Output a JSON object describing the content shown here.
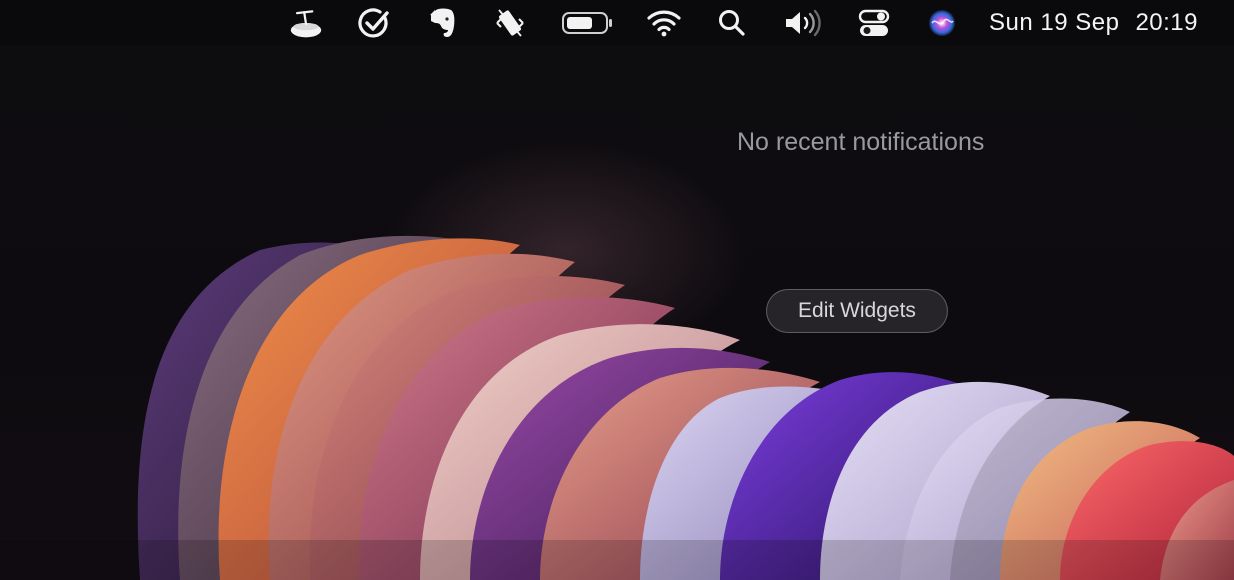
{
  "menubar": {
    "icons": [
      {
        "name": "dish-drawer-icon"
      },
      {
        "name": "things-check-icon"
      },
      {
        "name": "evernote-icon"
      },
      {
        "name": "screen-rotate-icon"
      },
      {
        "name": "battery-icon"
      },
      {
        "name": "wifi-icon"
      },
      {
        "name": "spotlight-search-icon"
      },
      {
        "name": "volume-icon"
      },
      {
        "name": "control-center-icon"
      },
      {
        "name": "siri-icon"
      }
    ],
    "date": "Sun 19 Sep",
    "time": "20:19"
  },
  "notification_center": {
    "empty_message": "No recent notifications",
    "edit_widgets_label": "Edit Widgets"
  },
  "colors": {
    "menubar_text": "#f2f2f2",
    "message_text": "#9a9a9e",
    "button_border": "#8c8a90"
  }
}
